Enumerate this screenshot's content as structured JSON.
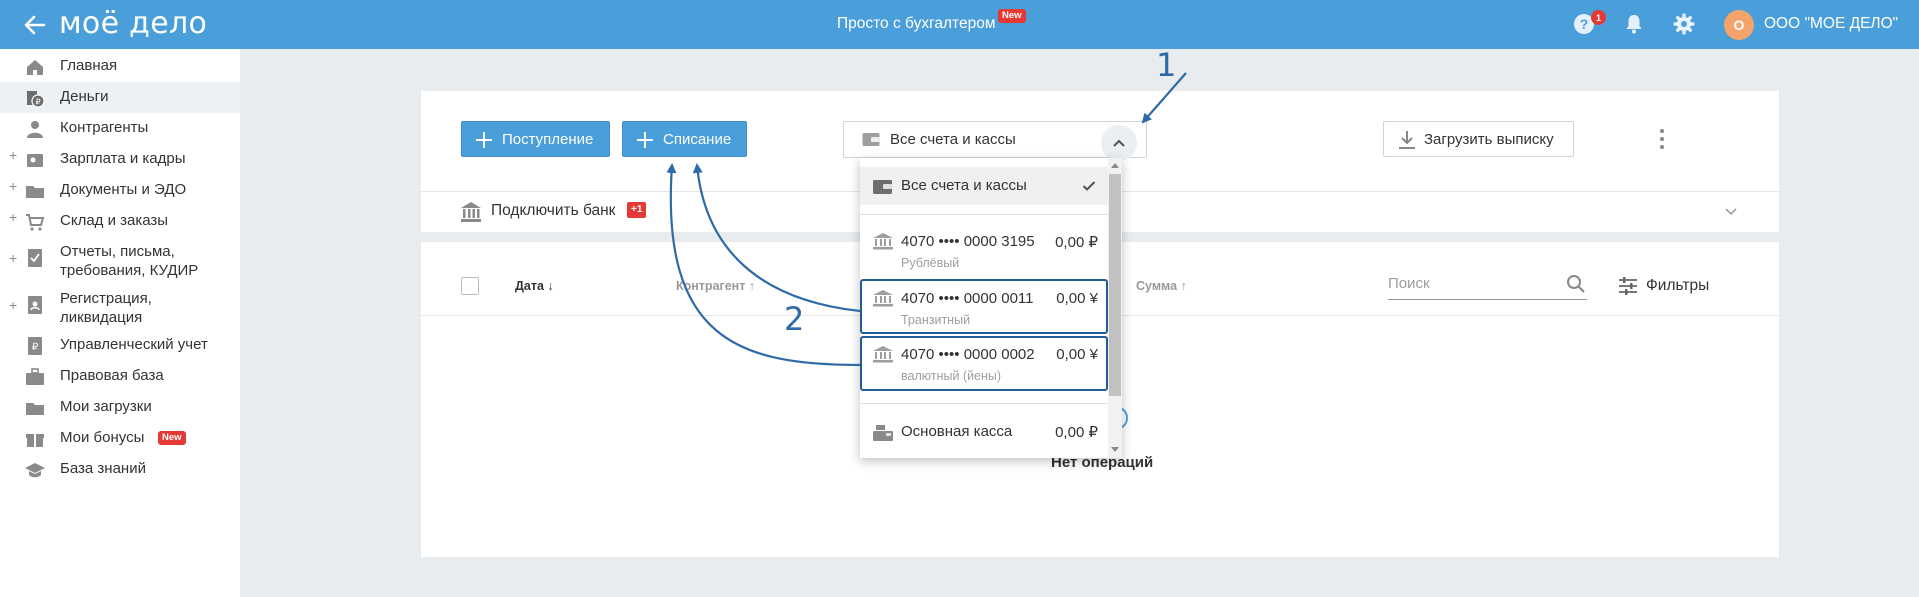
{
  "header": {
    "logo": "моё дело",
    "promo": "Просто с бухгалтером",
    "promo_badge": "New",
    "help_count": "1",
    "avatar_letter": "О",
    "company": "ООО \"МОЕ ДЕЛО\""
  },
  "sidebar": {
    "items": [
      {
        "label": "Главная",
        "icon": "home-icon",
        "expandable": false
      },
      {
        "label": "Деньги",
        "icon": "money-icon",
        "expandable": false,
        "active": true
      },
      {
        "label": "Контрагенты",
        "icon": "contractors-icon",
        "expandable": false
      },
      {
        "label": "Зарплата и кадры",
        "icon": "salary-icon",
        "expandable": true
      },
      {
        "label": "Документы и ЭДО",
        "icon": "folder-icon",
        "expandable": true
      },
      {
        "label": "Склад и заказы",
        "icon": "cart-icon",
        "expandable": true
      },
      {
        "label": "Отчеты, письма,",
        "label2": "требования, КУДИР",
        "icon": "report-icon",
        "expandable": true
      },
      {
        "label": "Регистрация,",
        "label2": "ликвидация",
        "icon": "registration-icon",
        "expandable": true
      },
      {
        "label": "Управленческий учет",
        "icon": "management-icon",
        "expandable": false
      },
      {
        "label": "Правовая база",
        "icon": "briefcase-icon",
        "expandable": false
      },
      {
        "label": "Мои загрузки",
        "icon": "folder-icon",
        "expandable": false
      },
      {
        "label": "Мои бонусы",
        "icon": "gift-icon",
        "expandable": false,
        "badge": "New"
      },
      {
        "label": "База знаний",
        "icon": "graduation-icon",
        "expandable": false
      }
    ]
  },
  "toolbar": {
    "income_label": "Поступление",
    "expense_label": "Списание",
    "account_select": "Все счета и кассы",
    "upload_label": "Загрузить выписку"
  },
  "bank": {
    "connect_label": "Подключить банк",
    "badge": "+1"
  },
  "table": {
    "columns": [
      "Дата",
      "Контрагент",
      "Сумма"
    ],
    "search_placeholder": "Поиск",
    "filters_label": "Фильтры",
    "empty_text": "Нет операций"
  },
  "dropdown": {
    "all_label": "Все счета и кассы",
    "accounts": [
      {
        "number": "4070 •••• 0000 3195",
        "subtitle": "Рублёвый",
        "amount": "0,00 ₽"
      },
      {
        "number": "4070 •••• 0000 0011",
        "subtitle": "Транзитный",
        "amount": "0,00 ¥"
      },
      {
        "number": "4070 •••• 0000 0002",
        "subtitle": "валютный (йены)",
        "amount": "0,00 ¥"
      }
    ],
    "cash": {
      "label": "Основная касса",
      "amount": "0,00 ₽"
    }
  },
  "annotations": {
    "one": "1",
    "two": "2"
  },
  "colors": {
    "brand": "#4a9fda",
    "annotation": "#2f6aa8",
    "badge": "#e53935"
  }
}
